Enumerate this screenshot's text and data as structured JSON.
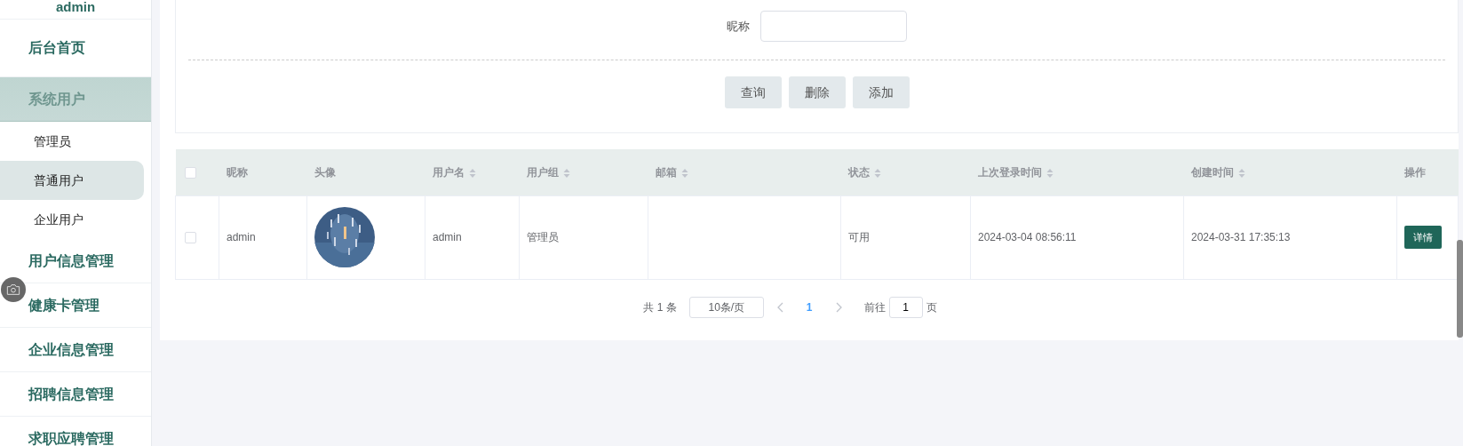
{
  "sidebar": {
    "user": "admin",
    "items": [
      {
        "label": "后台首页",
        "selected": false
      },
      {
        "label": "系统用户",
        "selected": true,
        "expanded": true,
        "children": [
          {
            "label": "管理员",
            "hovered": false
          },
          {
            "label": "普通用户",
            "hovered": true
          },
          {
            "label": "企业用户",
            "hovered": false
          }
        ]
      },
      {
        "label": "用户信息管理",
        "selected": false
      },
      {
        "label": "健康卡管理",
        "selected": false
      },
      {
        "label": "企业信息管理",
        "selected": false
      },
      {
        "label": "招聘信息管理",
        "selected": false
      },
      {
        "label": "求职应聘管理",
        "selected": false
      }
    ]
  },
  "search": {
    "fields": [
      {
        "label": "昵称"
      }
    ],
    "buttons": [
      "查询",
      "删除",
      "添加"
    ]
  },
  "table": {
    "columns": [
      {
        "label": "昵称",
        "sortable": false
      },
      {
        "label": "头像",
        "sortable": false
      },
      {
        "label": "用户名",
        "sortable": true
      },
      {
        "label": "用户组",
        "sortable": true
      },
      {
        "label": "邮箱",
        "sortable": true
      },
      {
        "label": "状态",
        "sortable": true
      },
      {
        "label": "上次登录时间",
        "sortable": true
      },
      {
        "label": "创建时间",
        "sortable": true
      },
      {
        "label": "操作",
        "sortable": false
      }
    ],
    "all_checked": false,
    "rows": [
      {
        "checked": false,
        "nickname": "admin",
        "username": "admin",
        "group": "管理员",
        "status": "可用",
        "last_login": "2024-03-04 08:56:11",
        "created": "2024-03-31 17:35:13",
        "action": "详情"
      }
    ]
  },
  "pagination": {
    "total": "共 1 条",
    "page_size": "10条/页",
    "pages": [
      {
        "label": "1",
        "selected": true
      }
    ],
    "goto_label": "前往",
    "goto_value": "1",
    "goto_suffix": "页"
  }
}
